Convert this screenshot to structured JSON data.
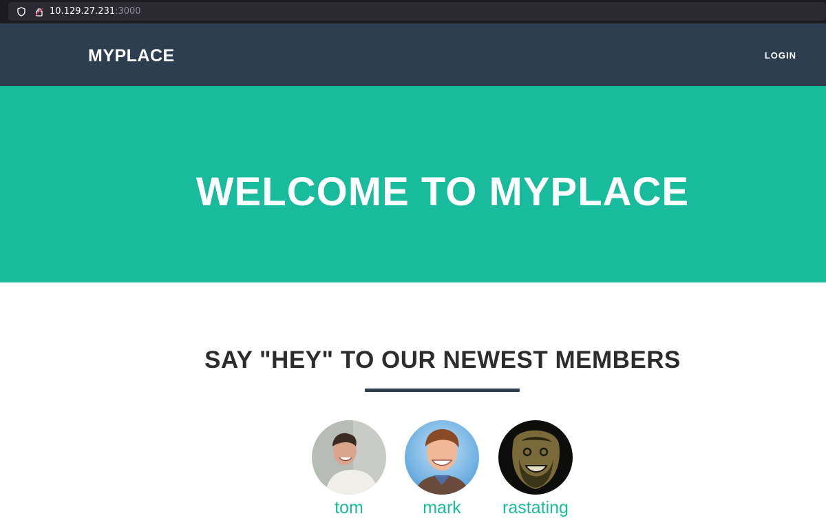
{
  "browser": {
    "url_host": "10.129.27.231",
    "url_port": ":3000",
    "icons": [
      "shield-icon",
      "lock-icon"
    ]
  },
  "navbar": {
    "brand": "MYPLACE",
    "login": "LOGIN"
  },
  "hero": {
    "title": "WELCOME TO MYPLACE"
  },
  "members": {
    "title": "SAY \"HEY\" TO OUR NEWEST MEMBERS",
    "list": [
      {
        "name": "tom"
      },
      {
        "name": "mark"
      },
      {
        "name": "rastating"
      }
    ]
  },
  "colors": {
    "navbar": "#2c3e50",
    "hero": "#18bc9c",
    "accent": "#18bc9c"
  }
}
